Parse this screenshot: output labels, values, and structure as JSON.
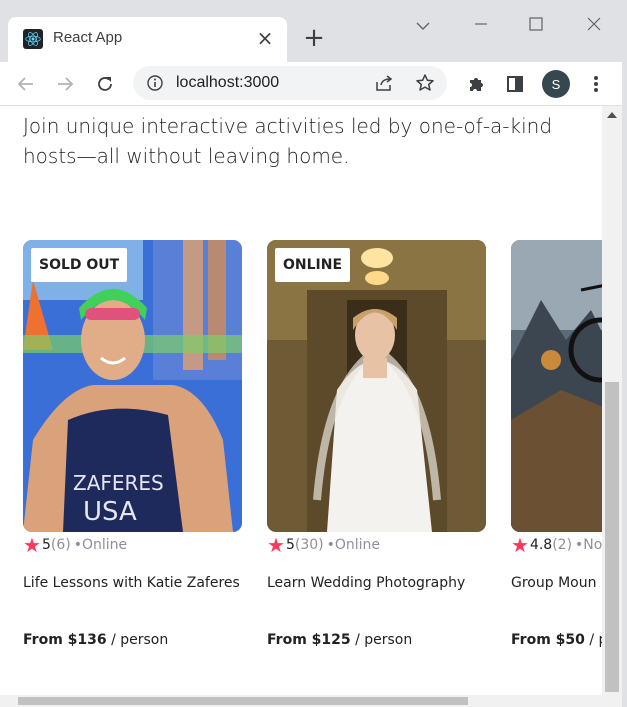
{
  "browser": {
    "tab_title": "React App",
    "url": "localhost:3000",
    "profile_initial": "S"
  },
  "page": {
    "intro_text": "Join unique interactive activities led by one-of-a-kind hosts—all without leaving home."
  },
  "cards": [
    {
      "badge": "SOLD OUT",
      "star": "★",
      "rating": "5",
      "review_count": "(6)",
      "location": "•Online",
      "title": "Life Lessons with Katie Zaferes",
      "price": "From $136",
      "price_unit": " / person"
    },
    {
      "badge": "ONLINE",
      "star": "★",
      "rating": "5",
      "review_count": "(30)",
      "location": "•Online",
      "title": "Learn Wedding Photography",
      "price": "From $125",
      "price_unit": " / person"
    },
    {
      "badge": "",
      "star": "★",
      "rating": "4.8",
      "review_count": "(2)",
      "location": "•No",
      "title": "Group Moun",
      "price": "From $50",
      "price_unit": " / p"
    }
  ],
  "colors": {
    "accent_star": "#fe395c",
    "muted_text": "#918e9b"
  }
}
